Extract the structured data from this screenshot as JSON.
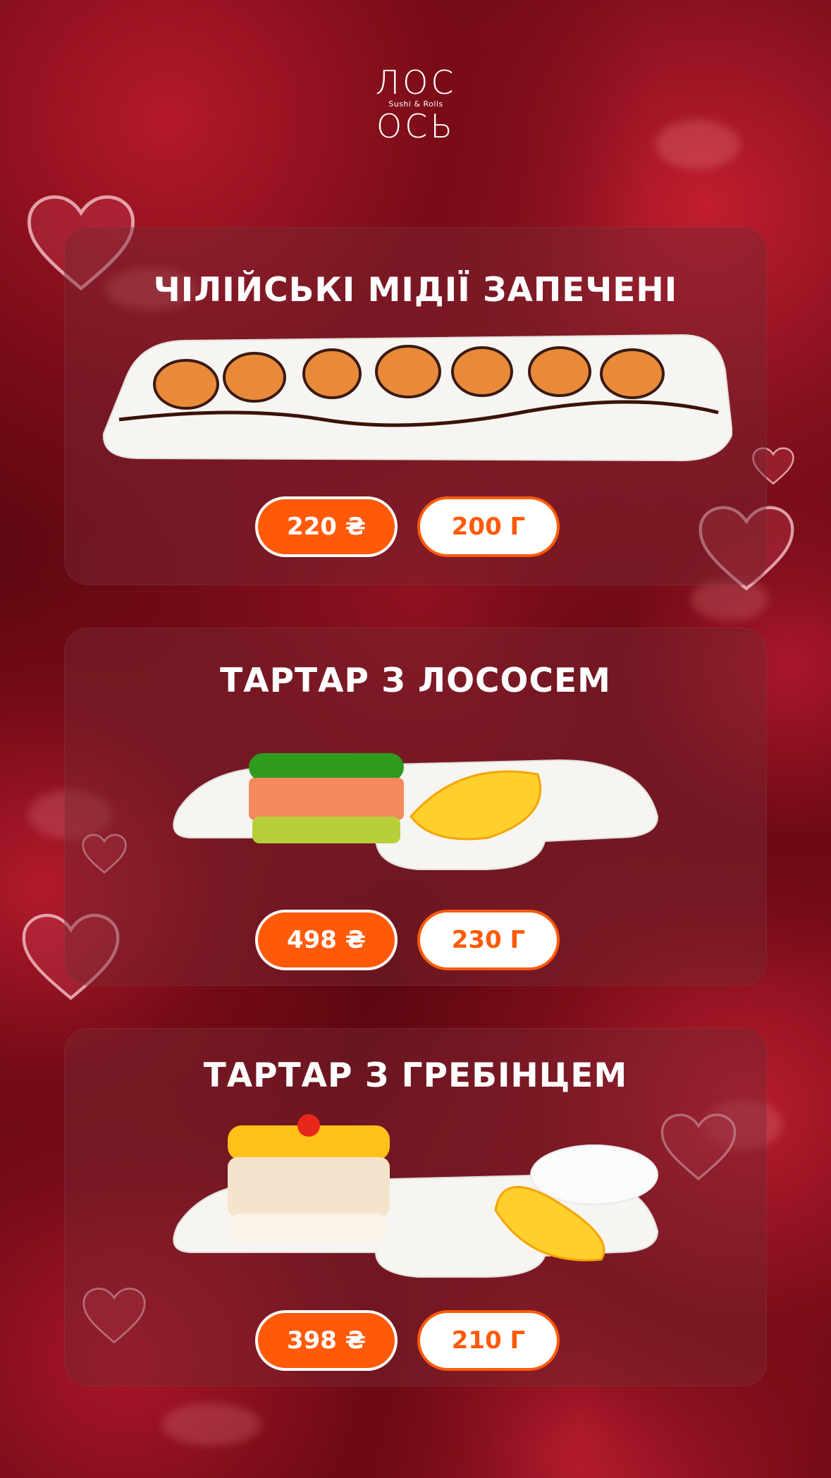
{
  "brand": {
    "line1": "ЛОС",
    "line2": "Sushi & Rolls",
    "line3": "ОСЬ"
  },
  "menu": [
    {
      "title": "ЧІЛІЙСЬКІ МІДІЇ ЗАПЕЧЕНІ",
      "price": "220 ₴",
      "weight": "200 Г",
      "image": "baked-mussels"
    },
    {
      "title": "ТАРТАР З ЛОСОСЕМ",
      "price": "498 ₴",
      "weight": "230 Г",
      "image": "salmon-tartare"
    },
    {
      "title": "ТАРТАР З ГРЕБІНЦЕМ",
      "price": "398 ₴",
      "weight": "210 Г",
      "image": "scallop-tartare"
    }
  ],
  "colors": {
    "accent": "#ff5a0a",
    "background": "#5a0a12",
    "card": "#782832"
  },
  "icons": [
    "heart-icon",
    "sushi-roll-logo-icon"
  ]
}
